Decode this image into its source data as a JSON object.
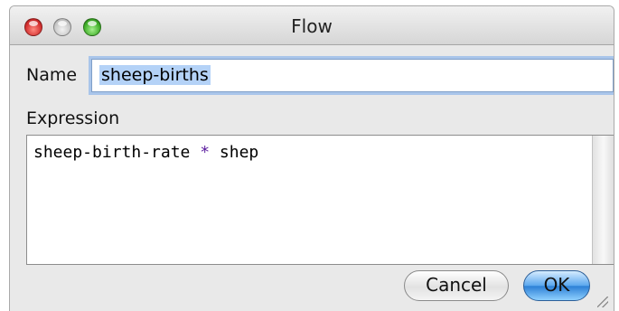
{
  "window": {
    "title": "Flow"
  },
  "name_field": {
    "label": "Name",
    "value": "sheep-births"
  },
  "expression": {
    "label": "Expression",
    "lhs": "sheep-birth-rate",
    "operator": "*",
    "rhs": "shep"
  },
  "buttons": {
    "cancel_label": "Cancel",
    "ok_label": "OK"
  },
  "colors": {
    "operator": "#5a1b9e",
    "selection": "#b4d2f7",
    "focus_ring": "#a9c5ea"
  },
  "icons": {
    "close": "close-icon",
    "minimize": "minimize-icon",
    "zoom": "zoom-icon",
    "resize": "resize-grip-icon"
  }
}
